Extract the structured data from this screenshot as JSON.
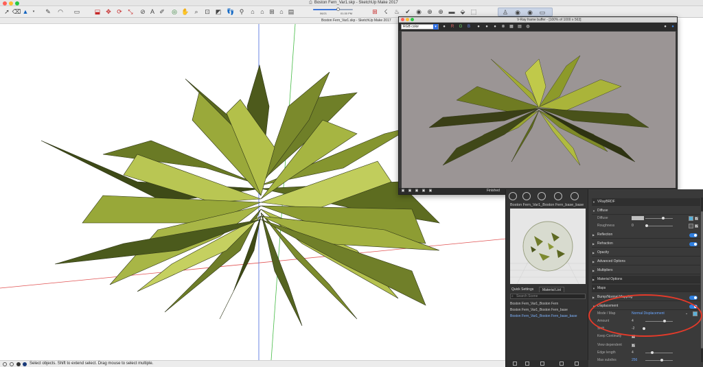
{
  "window": {
    "title": "Boston Fern_Var1.skp - SketchUp Make 2017",
    "doc_title": "Boston Fern_Var1.skp - SketchUp Make 2017"
  },
  "toolbar": {
    "shadow_time_left": "06/21",
    "shadow_time_right": "01:30 PM"
  },
  "colors": {
    "accent": "#2f7fe0",
    "axis_red": "#e05050",
    "axis_green": "#44bb44",
    "axis_blue": "#4466dd",
    "annotation": "#e53a2a"
  },
  "vfb": {
    "title": "V-Ray frame buffer - [100% of 1000 x 563]",
    "channel": "RGB color",
    "channel_buttons": [
      "R",
      "G",
      "B"
    ],
    "status": "Finished"
  },
  "editor": {
    "material_name": "Boston Fern_Var1_Boston Fern_base_base",
    "tabs": [
      "Quick Settings",
      "Material List"
    ],
    "search_placeholder": "Search Scene",
    "materials": [
      "Boston Fern_Var1_Boston Fern",
      "Boston Fern_Var1_Boston Fern_base",
      "Boston Fern_Var1_Boston Fern_base_base"
    ],
    "selected_material_index": 2,
    "sections": {
      "brdf": "VRayBRDF",
      "diffuse": "Diffuse",
      "diffuse_label": "Diffuse",
      "roughness_label": "Roughness",
      "roughness_value": "0",
      "reflection": "Reflection",
      "refraction": "Refraction",
      "opacity": "Opacity",
      "advanced": "Advanced Options",
      "multipliers": "Multipliers",
      "material_options": "Material Options",
      "maps": "Maps",
      "bump": "Bump/Normal Mapping",
      "displacement": "Displacement",
      "mode_label": "Mode / Map",
      "mode_value": "Normal Displacement",
      "amount_label": "Amount",
      "amount_value": "4",
      "shift_label": "Shift",
      "shift_value": "-2",
      "keep_label": "Keep Continuity",
      "view_dependent_label": "View dependent",
      "edge_length_label": "Edge length",
      "edge_length_value": "4",
      "max_subdivs_label": "Max subdivs",
      "max_subdivs_value": "256"
    }
  },
  "statusbar": {
    "text": "Select objects. Shift to extend select. Drag mouse to select multiple."
  }
}
